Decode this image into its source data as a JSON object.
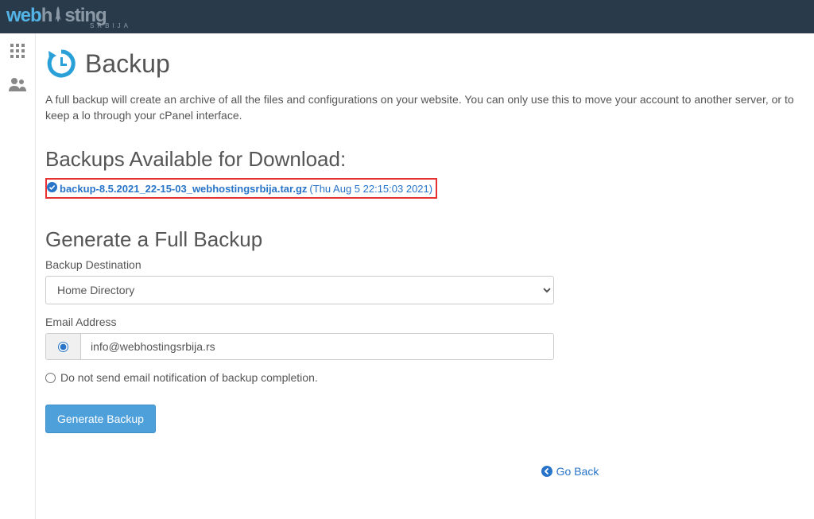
{
  "logo": {
    "part1": "web",
    "part2": "h",
    "part3": "sting",
    "sub": "SRBIJA"
  },
  "page": {
    "title": "Backup",
    "description": "A full backup will create an archive of all the files and configurations on your website. You can only use this to move your account to another server, or to keep a lo through your cPanel interface."
  },
  "sections": {
    "available_heading": "Backups Available for Download:",
    "generate_heading": "Generate a Full Backup"
  },
  "backup": {
    "filename": "backup-8.5.2021_22-15-03_webhostingsrbija.tar.gz",
    "date": "(Thu Aug 5 22:15:03 2021)"
  },
  "form": {
    "destination_label": "Backup Destination",
    "destination_value": "Home Directory",
    "email_label": "Email Address",
    "email_value": "info@webhostingsrbija.rs",
    "no_email_label": "Do not send email notification of backup completion.",
    "generate_button": "Generate Backup"
  },
  "nav": {
    "go_back": "Go Back"
  }
}
